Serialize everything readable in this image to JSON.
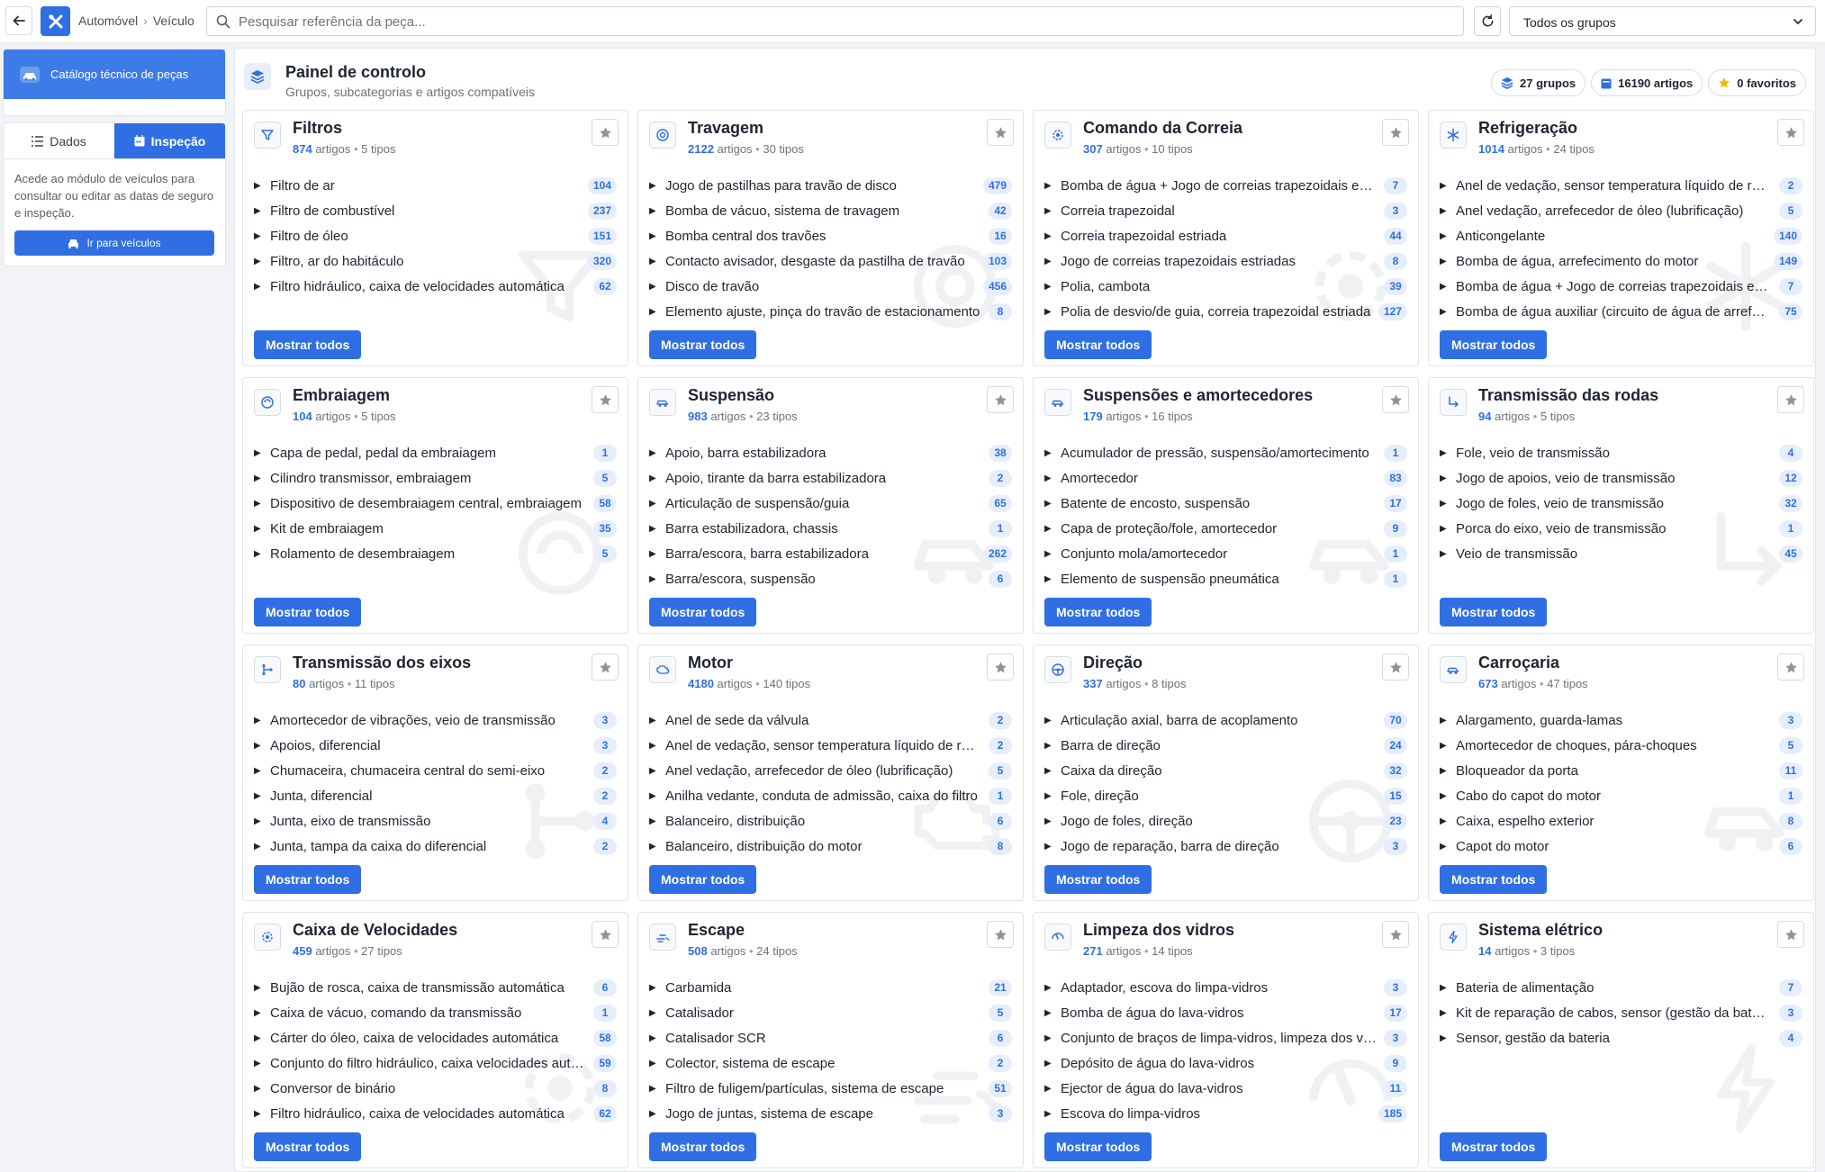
{
  "topbar": {
    "breadcrumb": [
      "Automóvel",
      "Veículo"
    ],
    "search_placeholder": "Pesquisar referência da peça...",
    "group_select": "Todos os grupos"
  },
  "sidebar": {
    "catalog_label": "Catálogo técnico de peças",
    "tabs": [
      {
        "label": "Dados",
        "active": false
      },
      {
        "label": "Inspeção",
        "active": true
      }
    ],
    "description": "Acede ao módulo de veículos para consultar ou editar as datas de seguro e inspeção.",
    "button_label": "Ir para veículos"
  },
  "header": {
    "title": "Painel de controlo",
    "subtitle": "Grupos, subcategorias e artigos compatíveis",
    "stats": {
      "groups": "27 grupos",
      "articles": "16190 artigos",
      "favorites": "0 favoritos"
    }
  },
  "more_label": "Mostrar todos",
  "groups": [
    {
      "name": "Filtros",
      "count": "874",
      "types": "5 tipos",
      "icon": "filter-icon",
      "items": [
        {
          "name": "Filtro de ar",
          "count": "104"
        },
        {
          "name": "Filtro de combustível",
          "count": "237"
        },
        {
          "name": "Filtro de óleo",
          "count": "151"
        },
        {
          "name": "Filtro, ar do habitáculo",
          "count": "320"
        },
        {
          "name": "Filtro hidráulico, caixa de velocidades automática",
          "count": "62"
        }
      ]
    },
    {
      "name": "Travagem",
      "count": "2122",
      "types": "30 tipos",
      "icon": "brake-disc-icon",
      "items": [
        {
          "name": "Jogo de pastilhas para travão de disco",
          "count": "479"
        },
        {
          "name": "Bomba de vácuo, sistema de travagem",
          "count": "42"
        },
        {
          "name": "Bomba central dos travões",
          "count": "16"
        },
        {
          "name": "Contacto avisador, desgaste da pastilha de travão",
          "count": "103"
        },
        {
          "name": "Disco de travão",
          "count": "456"
        },
        {
          "name": "Elemento ajuste, pinça do travão de estacionamento",
          "count": "8"
        }
      ]
    },
    {
      "name": "Comando da Correia",
      "count": "307",
      "types": "10 tipos",
      "icon": "cog-icon",
      "items": [
        {
          "name": "Bomba de água + Jogo de correias trapezoidais estriadas",
          "count": "7"
        },
        {
          "name": "Correia trapezoidal",
          "count": "3"
        },
        {
          "name": "Correia trapezoidal estriada",
          "count": "44"
        },
        {
          "name": "Jogo de correias trapezoidais estriadas",
          "count": "8"
        },
        {
          "name": "Polia, cambota",
          "count": "39"
        },
        {
          "name": "Polia de desvio/de guia, correia trapezoidal estriada",
          "count": "127"
        }
      ]
    },
    {
      "name": "Refrigeração",
      "count": "1014",
      "types": "24 tipos",
      "icon": "snowflake-icon",
      "items": [
        {
          "name": "Anel de vedação, sensor temperatura líquido de refrigeração",
          "count": "2"
        },
        {
          "name": "Anel vedação, arrefecedor de óleo (lubrificação)",
          "count": "5"
        },
        {
          "name": "Anticongelante",
          "count": "140"
        },
        {
          "name": "Bomba de água, arrefecimento do motor",
          "count": "149"
        },
        {
          "name": "Bomba de água + Jogo de correias trapezoidais estriadas",
          "count": "7"
        },
        {
          "name": "Bomba de água auxiliar (circuito de água de arrefecimento)",
          "count": "75"
        }
      ]
    },
    {
      "name": "Embraiagem",
      "count": "104",
      "types": "5 tipos",
      "icon": "clutch-icon",
      "items": [
        {
          "name": "Capa de pedal, pedal da embraiagem",
          "count": "1"
        },
        {
          "name": "Cilindro transmissor, embraiagem",
          "count": "5"
        },
        {
          "name": "Dispositivo de desembraiagem central, embraiagem",
          "count": "58"
        },
        {
          "name": "Kit de embraiagem",
          "count": "35"
        },
        {
          "name": "Rolamento de desembraiagem",
          "count": "5"
        }
      ]
    },
    {
      "name": "Suspensão",
      "count": "983",
      "types": "23 tipos",
      "icon": "car-side-icon",
      "items": [
        {
          "name": "Apoio, barra estabilizadora",
          "count": "38"
        },
        {
          "name": "Apoio, tirante da barra estabilizadora",
          "count": "2"
        },
        {
          "name": "Articulação de suspensão/guia",
          "count": "65"
        },
        {
          "name": "Barra estabilizadora, chassis",
          "count": "1"
        },
        {
          "name": "Barra/escora, barra estabilizadora",
          "count": "262"
        },
        {
          "name": "Barra/escora, suspensão",
          "count": "6"
        }
      ]
    },
    {
      "name": "Suspensões e amortecedores",
      "count": "179",
      "types": "16 tipos",
      "icon": "car-side-icon",
      "items": [
        {
          "name": "Acumulador de pressão, suspensão/amortecimento",
          "count": "1"
        },
        {
          "name": "Amortecedor",
          "count": "83"
        },
        {
          "name": "Batente de encosto, suspensão",
          "count": "17"
        },
        {
          "name": "Capa de proteção/fole, amortecedor",
          "count": "9"
        },
        {
          "name": "Conjunto mola/amortecedor",
          "count": "1"
        },
        {
          "name": "Elemento de suspensão pneumática",
          "count": "1"
        }
      ]
    },
    {
      "name": "Transmissão das rodas",
      "count": "94",
      "types": "5 tipos",
      "icon": "turn-arrow-icon",
      "items": [
        {
          "name": "Fole, veio de transmissão",
          "count": "4"
        },
        {
          "name": "Jogo de apoios, veio de transmissão",
          "count": "12"
        },
        {
          "name": "Jogo de foles, veio de transmissão",
          "count": "32"
        },
        {
          "name": "Porca do eixo, veio de transmissão",
          "count": "1"
        },
        {
          "name": "Veio de transmissão",
          "count": "45"
        }
      ]
    },
    {
      "name": "Transmissão dos eixos",
      "count": "80",
      "types": "11 tipos",
      "icon": "branch-icon",
      "items": [
        {
          "name": "Amortecedor de vibrações, veio de transmissão",
          "count": "3"
        },
        {
          "name": "Apoios, diferencial",
          "count": "3"
        },
        {
          "name": "Chumaceira, chumaceira central do semi-eixo",
          "count": "2"
        },
        {
          "name": "Junta, diferencial",
          "count": "2"
        },
        {
          "name": "Junta, eixo de transmissão",
          "count": "4"
        },
        {
          "name": "Junta, tampa da caixa do diferencial",
          "count": "2"
        }
      ]
    },
    {
      "name": "Motor",
      "count": "4180",
      "types": "140 tipos",
      "icon": "engine-icon",
      "items": [
        {
          "name": "Anel de sede da válvula",
          "count": "2"
        },
        {
          "name": "Anel de vedação, sensor temperatura líquido de refrigeração",
          "count": "2"
        },
        {
          "name": "Anel vedação, arrefecedor de óleo (lubrificação)",
          "count": "5"
        },
        {
          "name": "Anilha vedante, conduta de admissão, caixa do filtro",
          "count": "1"
        },
        {
          "name": "Balanceiro, distribuição",
          "count": "6"
        },
        {
          "name": "Balanceiro, distribuição do motor",
          "count": "8"
        }
      ]
    },
    {
      "name": "Direção",
      "count": "337",
      "types": "8 tipos",
      "icon": "steering-wheel-icon",
      "items": [
        {
          "name": "Articulação axial, barra de acoplamento",
          "count": "70"
        },
        {
          "name": "Barra de direção",
          "count": "24"
        },
        {
          "name": "Caixa da direção",
          "count": "32"
        },
        {
          "name": "Fole, direção",
          "count": "15"
        },
        {
          "name": "Jogo de foles, direção",
          "count": "23"
        },
        {
          "name": "Jogo de reparação, barra de direção",
          "count": "3"
        }
      ]
    },
    {
      "name": "Carroçaria",
      "count": "673",
      "types": "47 tipos",
      "icon": "car-side-icon",
      "items": [
        {
          "name": "Alargamento, guarda-lamas",
          "count": "3"
        },
        {
          "name": "Amortecedor de choques, pára-choques",
          "count": "5"
        },
        {
          "name": "Bloqueador da porta",
          "count": "11"
        },
        {
          "name": "Cabo do capot do motor",
          "count": "1"
        },
        {
          "name": "Caixa, espelho exterior",
          "count": "8"
        },
        {
          "name": "Capot do motor",
          "count": "6"
        }
      ]
    },
    {
      "name": "Caixa de Velocidades",
      "count": "459",
      "types": "27 tipos",
      "icon": "cog-icon",
      "items": [
        {
          "name": "Bujão de rosca, caixa de transmissão automática",
          "count": "6"
        },
        {
          "name": "Caixa de vácuo, comando da transmissão",
          "count": "1"
        },
        {
          "name": "Cárter do óleo, caixa de velocidades automática",
          "count": "58"
        },
        {
          "name": "Conjunto do filtro hidráulico, caixa velocidades automática",
          "count": "59"
        },
        {
          "name": "Conversor de binário",
          "count": "8"
        },
        {
          "name": "Filtro hidráulico, caixa de velocidades automática",
          "count": "62"
        }
      ]
    },
    {
      "name": "Escape",
      "count": "508",
      "types": "24 tipos",
      "icon": "exhaust-icon",
      "items": [
        {
          "name": "Carbamida",
          "count": "21"
        },
        {
          "name": "Catalisador",
          "count": "5"
        },
        {
          "name": "Catalisador SCR",
          "count": "6"
        },
        {
          "name": "Colector, sistema de escape",
          "count": "2"
        },
        {
          "name": "Filtro de fuligem/partículas, sistema de escape",
          "count": "51"
        },
        {
          "name": "Jogo de juntas, sistema de escape",
          "count": "3"
        }
      ]
    },
    {
      "name": "Limpeza dos vidros",
      "count": "271",
      "types": "14 tipos",
      "icon": "wiper-icon",
      "items": [
        {
          "name": "Adaptador, escova do limpa-vidros",
          "count": "3"
        },
        {
          "name": "Bomba de água do lava-vidros",
          "count": "17"
        },
        {
          "name": "Conjunto de braços de limpa-vidros, limpeza dos vidros",
          "count": "3"
        },
        {
          "name": "Depósito de água do lava-vidros",
          "count": "9"
        },
        {
          "name": "Ejector de água do lava-vidros",
          "count": "11"
        },
        {
          "name": "Escova do limpa-vidros",
          "count": "185"
        }
      ]
    },
    {
      "name": "Sistema elétrico",
      "count": "14",
      "types": "3 tipos",
      "icon": "bolt-icon",
      "items": [
        {
          "name": "Bateria de alimentação",
          "count": "7"
        },
        {
          "name": "Kit de reparação de cabos, sensor (gestão da bateria)",
          "count": "3"
        },
        {
          "name": "Sensor, gestão da bateria",
          "count": "4"
        }
      ]
    }
  ]
}
